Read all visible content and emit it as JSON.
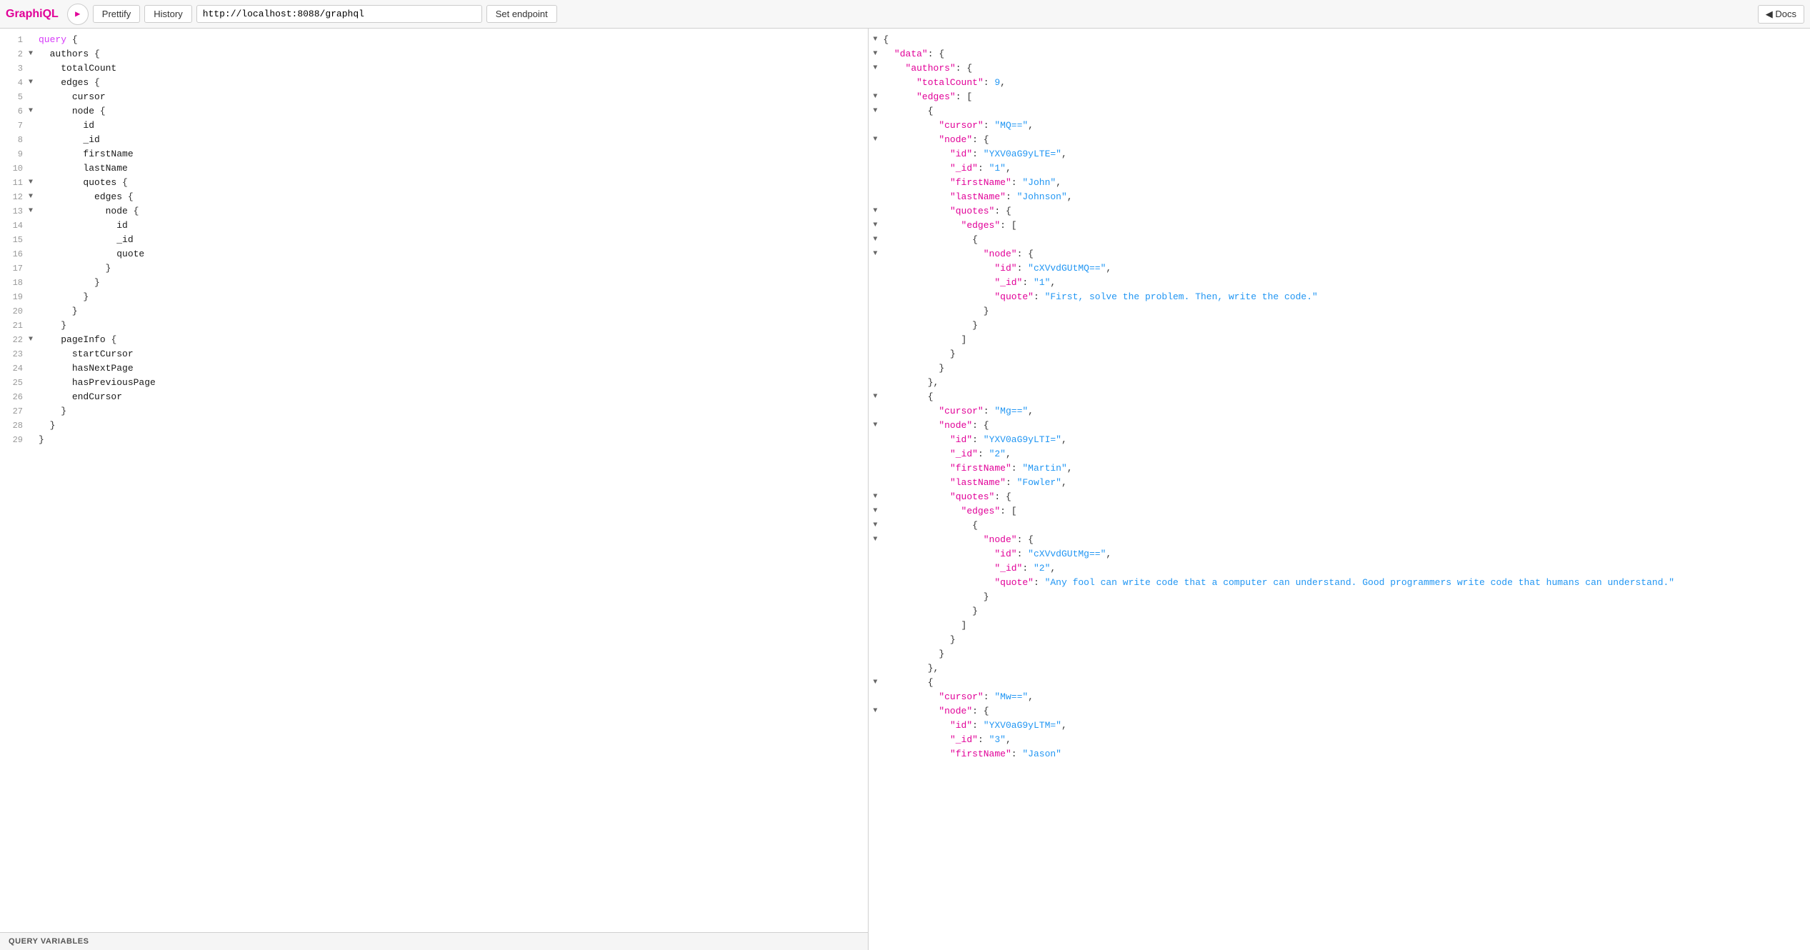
{
  "toolbar": {
    "app_title": "GraphiQL",
    "run_button_icon": "▶",
    "prettify_label": "Prettify",
    "history_label": "History",
    "endpoint_value": "http://localhost:8088/graphql",
    "set_endpoint_label": "Set endpoint",
    "docs_label": "◀ Docs"
  },
  "query_editor": {
    "lines": [
      {
        "num": "1",
        "arrow": "",
        "indent": "",
        "content": "query {"
      },
      {
        "num": "2",
        "arrow": "▼",
        "indent": "  ",
        "content": "authors {"
      },
      {
        "num": "3",
        "arrow": "",
        "indent": "    ",
        "content": "totalCount"
      },
      {
        "num": "4",
        "arrow": "▼",
        "indent": "    ",
        "content": "edges {"
      },
      {
        "num": "5",
        "arrow": "",
        "indent": "      ",
        "content": "cursor"
      },
      {
        "num": "6",
        "arrow": "▼",
        "indent": "      ",
        "content": "node {"
      },
      {
        "num": "7",
        "arrow": "",
        "indent": "        ",
        "content": "id"
      },
      {
        "num": "8",
        "arrow": "",
        "indent": "        ",
        "content": "_id"
      },
      {
        "num": "9",
        "arrow": "",
        "indent": "        ",
        "content": "firstName"
      },
      {
        "num": "10",
        "arrow": "",
        "indent": "        ",
        "content": "lastName"
      },
      {
        "num": "11",
        "arrow": "▼",
        "indent": "        ",
        "content": "quotes {"
      },
      {
        "num": "12",
        "arrow": "▼",
        "indent": "          ",
        "content": "edges {"
      },
      {
        "num": "13",
        "arrow": "▼",
        "indent": "            ",
        "content": "node {"
      },
      {
        "num": "14",
        "arrow": "",
        "indent": "              ",
        "content": "id"
      },
      {
        "num": "15",
        "arrow": "",
        "indent": "              ",
        "content": "_id"
      },
      {
        "num": "16",
        "arrow": "",
        "indent": "              ",
        "content": "quote"
      },
      {
        "num": "17",
        "arrow": "",
        "indent": "            ",
        "content": "}"
      },
      {
        "num": "18",
        "arrow": "",
        "indent": "          ",
        "content": "}"
      },
      {
        "num": "19",
        "arrow": "",
        "indent": "        ",
        "content": "}"
      },
      {
        "num": "20",
        "arrow": "",
        "indent": "      ",
        "content": "}"
      },
      {
        "num": "21",
        "arrow": "",
        "indent": "    ",
        "content": "}"
      },
      {
        "num": "22",
        "arrow": "▼",
        "indent": "    ",
        "content": "pageInfo {"
      },
      {
        "num": "23",
        "arrow": "",
        "indent": "      ",
        "content": "startCursor"
      },
      {
        "num": "24",
        "arrow": "",
        "indent": "      ",
        "content": "hasNextPage"
      },
      {
        "num": "25",
        "arrow": "",
        "indent": "      ",
        "content": "hasPreviousPage"
      },
      {
        "num": "26",
        "arrow": "",
        "indent": "      ",
        "content": "endCursor"
      },
      {
        "num": "27",
        "arrow": "",
        "indent": "    ",
        "content": "}"
      },
      {
        "num": "28",
        "arrow": "",
        "indent": "  ",
        "content": "}"
      },
      {
        "num": "29",
        "arrow": "",
        "indent": "",
        "content": "}"
      }
    ]
  },
  "query_variables_label": "QUERY VARIABLES",
  "result": {
    "raw": [
      "{",
      "  \"data\": {",
      "    \"authors\": {",
      "      \"totalCount\": 9,",
      "      \"edges\": [",
      "        {",
      "          \"cursor\": \"MQ==\",",
      "          \"node\": {",
      "            \"id\": \"YXV0aG9yLTE=\",",
      "            \"_id\": \"1\",",
      "            \"firstName\": \"John\",",
      "            \"lastName\": \"Johnson\",",
      "            \"quotes\": {",
      "              \"edges\": [",
      "                {",
      "                  \"node\": {",
      "                    \"id\": \"cXVvdGUtMQ==\",",
      "                    \"_id\": \"1\",",
      "                    \"quote\": \"First, solve the problem. Then, write the code.\"",
      "                  }",
      "                }",
      "              ]",
      "            }",
      "          }",
      "        },",
      "        {",
      "          \"cursor\": \"Mg==\",",
      "          \"node\": {",
      "            \"id\": \"YXV0aG9yLTI=\",",
      "            \"_id\": \"2\",",
      "            \"firstName\": \"Martin\",",
      "            \"lastName\": \"Fowler\",",
      "            \"quotes\": {",
      "              \"edges\": [",
      "                {",
      "                  \"node\": {",
      "                    \"id\": \"cXVvdGUtMg==\",",
      "                    \"_id\": \"2\",",
      "                    \"quote\": \"Any fool can write code that a computer can understand. Good programmers write code that humans can understand.\"",
      "                  }",
      "                }",
      "              ]",
      "            }",
      "          }",
      "        },",
      "        {",
      "          \"cursor\": \"Mw==\",",
      "          \"node\": {",
      "            \"id\": \"YXV0aG9yLTM=\",",
      "            \"_id\": \"3\",",
      "            \"firstName\": \"Jason\""
    ]
  }
}
